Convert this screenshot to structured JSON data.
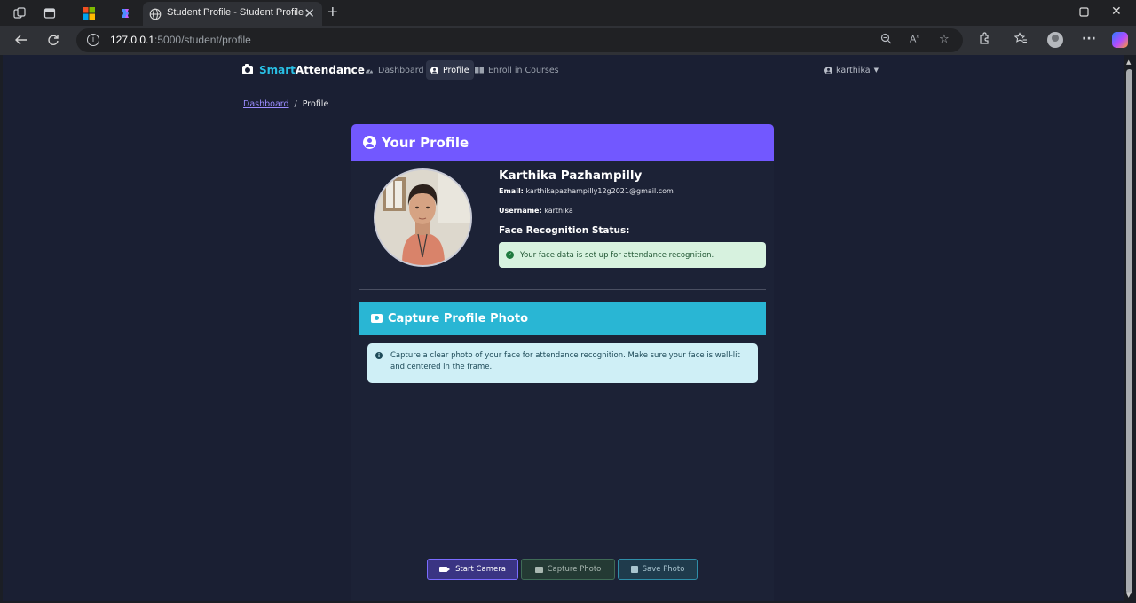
{
  "browser": {
    "tab_title": "Student Profile - Student Profile",
    "url_host": "127.0.0.1",
    "url_rest": ":5000/student/profile",
    "icons": [
      "workspaces-icon",
      "tab-actions-icon",
      "microsoft-store-icon",
      "copilot-icon",
      "globe-icon",
      "close-icon",
      "new-tab-icon",
      "minimize-icon",
      "maximize-icon",
      "window-close-icon",
      "back-icon",
      "refresh-icon",
      "info-icon",
      "zoom-icon",
      "read-aloud-icon",
      "favorite-icon",
      "extensions-icon",
      "favorites-icon",
      "profile-icon",
      "more-icon"
    ]
  },
  "navbar": {
    "brand_smart": "Smart",
    "brand_attendance": "Attendance",
    "links": [
      {
        "label": "Dashboard",
        "icon": "speedometer-icon",
        "active": false
      },
      {
        "label": "Profile",
        "icon": "user-circle-icon",
        "active": true
      },
      {
        "label": "Enroll in Courses",
        "icon": "book-icon",
        "active": false
      }
    ],
    "user": "karthika"
  },
  "breadcrumb": {
    "items": [
      "Dashboard",
      "/",
      "Profile"
    ]
  },
  "profile": {
    "header": "Your Profile",
    "name": "Karthika Pazhampilly",
    "email_label": "Email:",
    "email": "karthikapazhampilly12g2021@gmail.com",
    "username_label": "Username:",
    "username": "karthika",
    "face_status_label": "Face Recognition Status:",
    "face_status_message": "Your face data is set up for attendance recognition."
  },
  "capture": {
    "header": "Capture Profile Photo",
    "info": "Capture a clear photo of your face for attendance recognition. Make sure your face is well-lit and centered in the frame.",
    "buttons": {
      "start": "Start Camera",
      "capture": "Capture Photo",
      "save": "Save Photo"
    }
  },
  "colors": {
    "profile_header": "#7258ff",
    "capture_header": "#29b6d4",
    "brand_accent": "#29c0e6",
    "page_bg": "#1a1f33"
  }
}
